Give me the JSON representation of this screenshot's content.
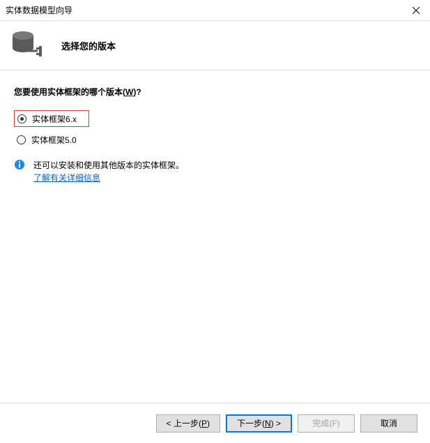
{
  "titlebar": {
    "title": "实体数据模型向导"
  },
  "header": {
    "title": "选择您的版本"
  },
  "question": {
    "prefix": "您要使用实体框架的哪个版本(",
    "hotkey": "W",
    "suffix": ")?"
  },
  "options": {
    "o1": "实体框架6.x",
    "o2": "实体框架5.0"
  },
  "info": {
    "text": "还可以安装和使用其他版本的实体框架。",
    "link": "了解有关详细信息"
  },
  "buttons": {
    "back_prefix": "< 上一步(",
    "back_hotkey": "P",
    "back_suffix": ")",
    "next_prefix": "下一步(",
    "next_hotkey": "N",
    "next_suffix": ") >",
    "finish_prefix": "完成(",
    "finish_hotkey": "F",
    "finish_suffix": ")",
    "cancel": "取消"
  }
}
